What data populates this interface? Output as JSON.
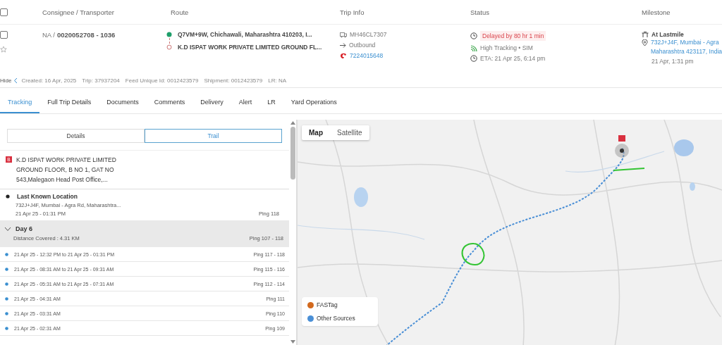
{
  "table": {
    "header_checked": false,
    "columns": [
      {
        "label": "Consignee / Transporter"
      },
      {
        "label": "Route"
      },
      {
        "label": "Trip Info"
      },
      {
        "label": "Status"
      },
      {
        "label": "Milestone"
      }
    ],
    "row": {
      "checked": false,
      "starred": false,
      "consignee_prefix": "NA /",
      "consignee": "0020052708 - 1036",
      "route": [
        {
          "kind": "origin",
          "text": "Q7VM+9W, Chichawali, Maharashtra 410203, I..."
        },
        {
          "kind": "destination",
          "text": "K.D ISPAT WORK PRIVATE LIMITED GROUND FL..."
        }
      ],
      "trip_info": {
        "vehicle": "MH46CL7307",
        "direction": "Outbound",
        "phone": "7224015648"
      },
      "status": {
        "delay": "Delayed by 80 hr 1 min",
        "tracking": "High Tracking • SIM",
        "eta": "ETA: 21 Apr 25, 6:14 pm"
      },
      "milestone": {
        "title": "At Lastmile",
        "address_lines": [
          "732J+J4F, Mumbai - Agra",
          "Maharashtra 423117, India"
        ],
        "time": "21 Apr, 1:31 pm"
      }
    }
  },
  "meta": {
    "hide": "Hide",
    "items": [
      "Created: 16 Apr, 2025",
      "Trip: 37937204",
      "Feed Unique Id: 0012423579",
      "Shipment: 0012423579",
      "LR: NA"
    ]
  },
  "tabs": [
    {
      "label": "Tracking",
      "selected": true
    },
    {
      "label": "Full Trip Details",
      "selected": false
    },
    {
      "label": "Documents",
      "selected": false
    },
    {
      "label": "Comments",
      "selected": false
    },
    {
      "label": "Delivery",
      "selected": false
    },
    {
      "label": "Alert",
      "selected": false
    },
    {
      "label": "LR",
      "selected": false
    },
    {
      "label": "Yard Operations",
      "selected": false
    }
  ],
  "view_tabs": [
    {
      "label": "Details",
      "selected": false
    },
    {
      "label": "Trail",
      "selected": true
    }
  ],
  "destination": {
    "badge": "B",
    "address_lines": [
      "K.D ISPAT WORK PRIVATE LIMITED",
      "GROUND FLOOR, B NO 1, GAT NO",
      "543,Malegaon Head Post Office,..."
    ]
  },
  "last_known": {
    "title": "Last Known Location",
    "address": "732J+J4F, Mumbai - Agra Rd, Maharashtra...",
    "time": "21 Apr 25 - 01:31 PM",
    "ping": "Ping 118"
  },
  "day_group": {
    "expanded": true,
    "title": "Day 6",
    "distance": "Distance Covered : 4.31 KM",
    "ping": "Ping 107 - 118",
    "entries": [
      {
        "time": "21 Apr 25 - 12:32 PM to 21 Apr 25 - 01:31 PM",
        "ping": "Ping 117 - 118"
      },
      {
        "time": "21 Apr 25 - 08:31 AM to 21 Apr 25 - 09:31 AM",
        "ping": "Ping 115 - 116"
      },
      {
        "time": "21 Apr 25 - 05:31 AM to 21 Apr 25 - 07:31 AM",
        "ping": "Ping 112 - 114"
      },
      {
        "time": "21 Apr 25 - 04:31 AM",
        "ping": "Ping 111"
      },
      {
        "time": "21 Apr 25 - 03:31 AM",
        "ping": "Ping 110"
      },
      {
        "time": "21 Apr 25 - 02:31 AM",
        "ping": "Ping 109"
      }
    ]
  },
  "map": {
    "view_toggle": [
      {
        "label": "Map",
        "selected": true
      },
      {
        "label": "Satellite",
        "selected": false
      }
    ],
    "legend": [
      {
        "label": "FASTag",
        "color": "#d2691e"
      },
      {
        "label": "Other Sources",
        "color": "#4a8fd6"
      }
    ]
  }
}
